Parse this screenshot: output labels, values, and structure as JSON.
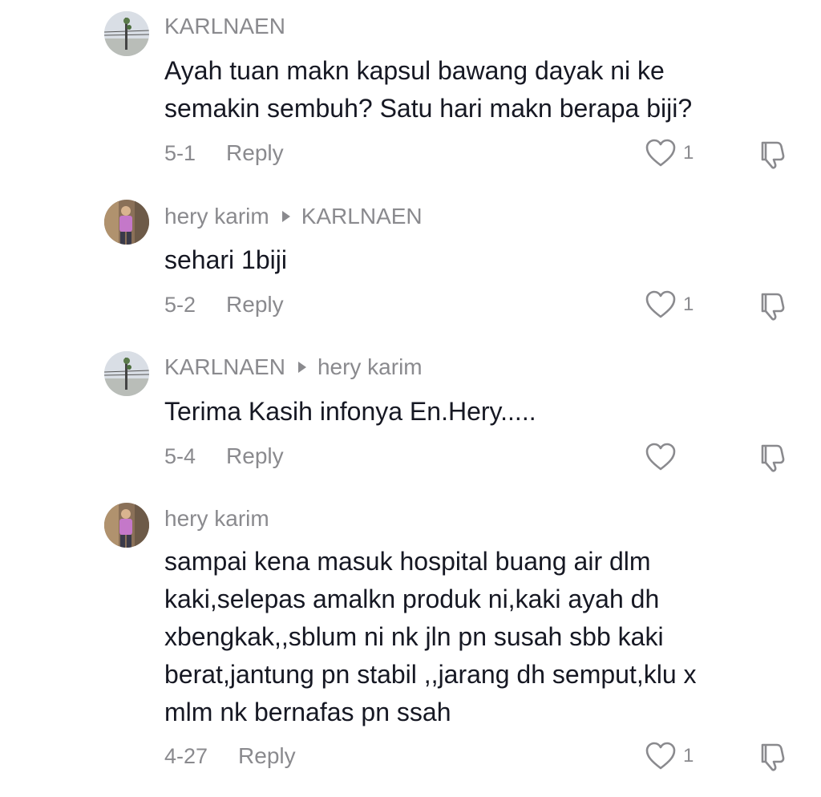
{
  "comments": [
    {
      "author": "KARLNAEN",
      "reply_to": "",
      "avatar": "landscape-avatar",
      "text": [
        "Ayah tuan makn kapsul bawang dayak ni ke",
        "semakin sembuh? Satu hari makn berapa biji?"
      ],
      "date": "5-1",
      "reply_label": "Reply",
      "likes": "1"
    },
    {
      "author": "hery karim",
      "reply_to": "KARLNAEN",
      "avatar": "person-avatar",
      "text": [
        "sehari 1biji"
      ],
      "date": "5-2",
      "reply_label": "Reply",
      "likes": "1"
    },
    {
      "author": "KARLNAEN",
      "reply_to": "hery karim",
      "avatar": "landscape-avatar",
      "text": [
        "Terima Kasih infonya En.Hery....."
      ],
      "date": "5-4",
      "reply_label": "Reply",
      "likes": ""
    },
    {
      "author": "hery karim",
      "reply_to": "",
      "avatar": "person-avatar",
      "text": [
        "sampai kena masuk hospital buang air dlm",
        "kaki,selepas amalkn produk ni,kaki ayah dh",
        "xbengkak,,sblum ni nk jln pn susah sbb kaki",
        "berat,jantung pn stabil ,,jarang dh semput,klu x",
        "mlm nk bernafas pn ssah"
      ],
      "date": "4-27",
      "reply_label": "Reply",
      "likes": "1"
    }
  ],
  "icons": {
    "like": "heart-outline-icon",
    "dislike": "thumbs-down-icon"
  },
  "colors": {
    "meta_gray": "#8a8a8e",
    "text_dark": "#161823"
  }
}
